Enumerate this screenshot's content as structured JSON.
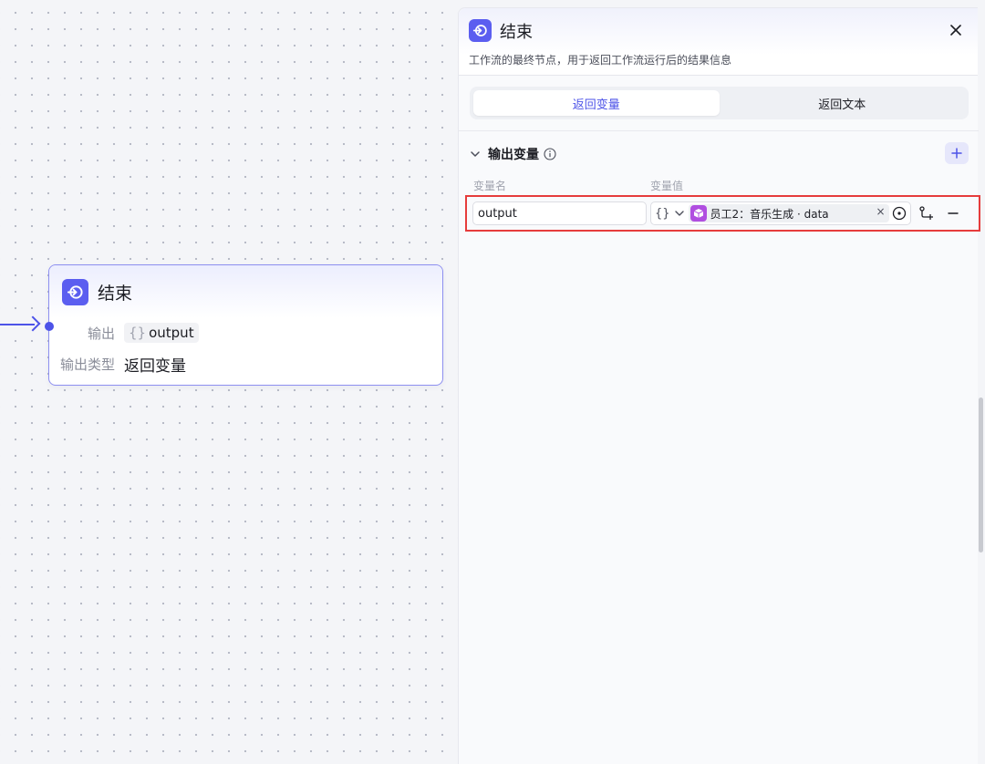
{
  "canvas": {
    "node": {
      "title": "结束",
      "icon": "end-node-icon",
      "output_label": "输出",
      "output_brace": "{}",
      "output_value": "output",
      "type_label": "输出类型",
      "type_value": "返回变量"
    }
  },
  "panel": {
    "title": "结束",
    "description": "工作流的最终节点，用于返回工作流运行后的结果信息",
    "tabs": [
      {
        "label": "返回变量",
        "active": true
      },
      {
        "label": "返回文本",
        "active": false
      }
    ],
    "section": {
      "title": "输出变量",
      "columns": {
        "name": "变量名",
        "value": "变量值"
      },
      "rows": [
        {
          "name": "output",
          "type_icon": "{}",
          "reference": "员工2：音乐生成 · data"
        }
      ]
    }
  },
  "colors": {
    "accent": "#4d53e8",
    "node_icon": "#5b5ef0",
    "chip_icon": "#b04ee0",
    "highlight_border": "#e63c3c"
  }
}
